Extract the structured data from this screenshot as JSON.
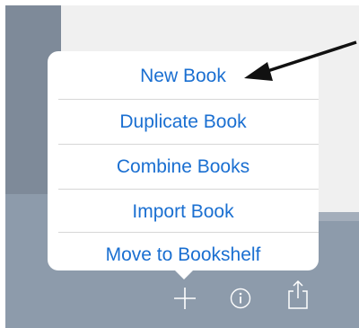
{
  "menu": {
    "items": [
      {
        "label": "New Book"
      },
      {
        "label": "Duplicate Book"
      },
      {
        "label": "Combine Books"
      },
      {
        "label": "Import Book"
      },
      {
        "label": "Move to Bookshelf"
      }
    ]
  },
  "toolbar": {
    "icons": [
      "plus-icon",
      "info-icon",
      "share-icon"
    ]
  },
  "colors": {
    "menu_text": "#1a6fd1",
    "background": "#8d9bab",
    "popover": "#ffffff"
  }
}
